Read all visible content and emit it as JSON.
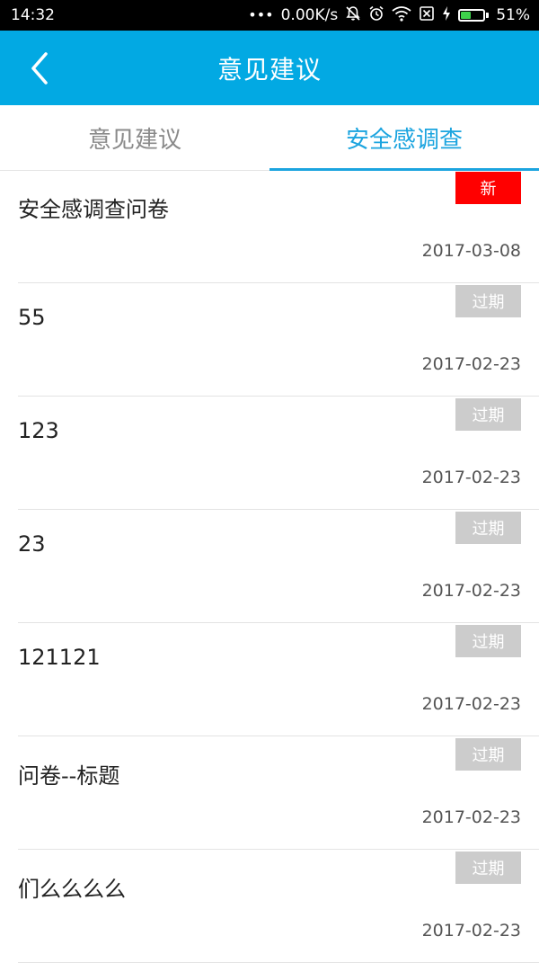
{
  "status_bar": {
    "time": "14:32",
    "dots": "•••",
    "network_speed": "0.00K/s",
    "icons": [
      "mute-bell-icon",
      "alarm-icon",
      "wifi-icon",
      "no-sim-icon",
      "charging-icon"
    ],
    "battery_percent": 51,
    "battery_text": "51%",
    "battery_color": "#3fd14b"
  },
  "app_bar": {
    "title": "意见建议",
    "background": "#02a9e3"
  },
  "tabs": [
    {
      "label": "意见建议",
      "active": false
    },
    {
      "label": "安全感调查",
      "active": true
    }
  ],
  "list": {
    "items": [
      {
        "title": "安全感调查问卷",
        "date": "2017-03-08",
        "badge": "新",
        "badge_type": "new"
      },
      {
        "title": "55",
        "date": "2017-02-23",
        "badge": "过期",
        "badge_type": "expired"
      },
      {
        "title": "123",
        "date": "2017-02-23",
        "badge": "过期",
        "badge_type": "expired"
      },
      {
        "title": "23",
        "date": "2017-02-23",
        "badge": "过期",
        "badge_type": "expired"
      },
      {
        "title": "121121",
        "date": "2017-02-23",
        "badge": "过期",
        "badge_type": "expired"
      },
      {
        "title": "问卷--标题",
        "date": "2017-02-23",
        "badge": "过期",
        "badge_type": "expired"
      },
      {
        "title": "们么么么么",
        "date": "2017-02-23",
        "badge": "过期",
        "badge_type": "expired"
      }
    ]
  }
}
